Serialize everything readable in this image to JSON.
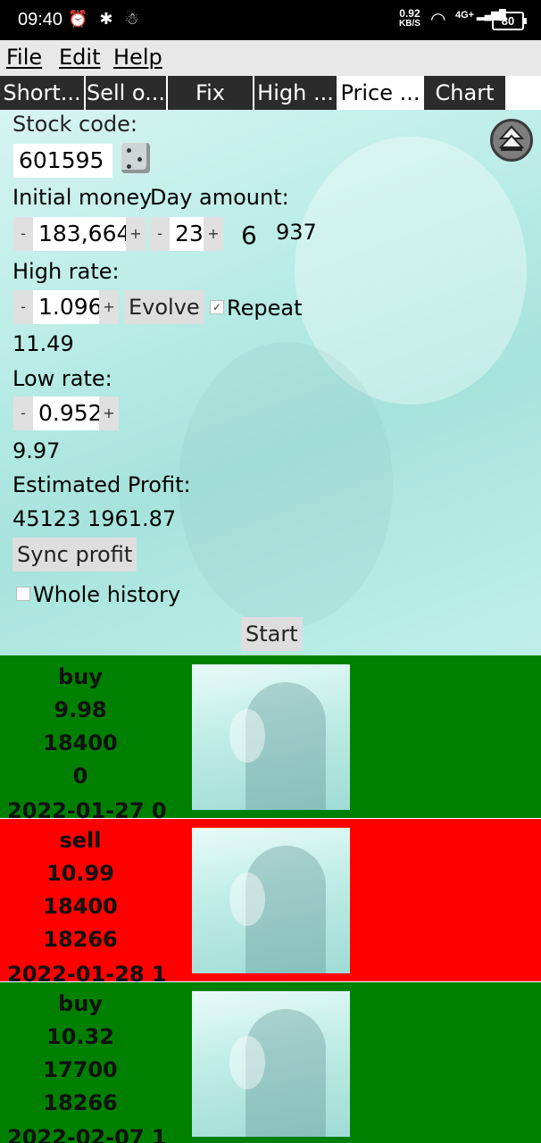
{
  "status_bar": {
    "time": "09:40",
    "left_icons": "⏰ ✱ ☃",
    "speed_value": "0.92",
    "speed_unit": "KB/S",
    "network": "4G+",
    "battery": "80"
  },
  "menu": [
    "File",
    "Edit",
    "Help"
  ],
  "tabs": [
    {
      "label": "Short..."
    },
    {
      "label": "Sell o..."
    },
    {
      "label": "Fix"
    },
    {
      "label": "High ..."
    },
    {
      "label": "Price ..."
    },
    {
      "label": "Chart"
    }
  ],
  "form": {
    "stock_code_label": "Stock code:",
    "stock_code_value": "601595",
    "initial_money_label": "Initial money",
    "day_amount_label": "Day amount:",
    "initial_money_value": "183,664",
    "day_amount_value": "23",
    "extra_a": "6",
    "extra_b": "937",
    "high_rate_label": "High rate:",
    "high_rate_value": "1.096",
    "evolve_label": "Evolve",
    "repeat_label": "Repeat",
    "repeat_checked": true,
    "high_price": "11.49",
    "low_rate_label": "Low rate:",
    "low_rate_value": "0.952",
    "low_price": "9.97",
    "estimated_profit_label": "Estimated Profit:",
    "estimated_profit_value": "45123 1961.87",
    "sync_profit_label": "Sync profit",
    "whole_history_label": "Whole history",
    "whole_history_checked": false,
    "start_label": "Start",
    "minus": "-",
    "plus": "+"
  },
  "transactions": [
    {
      "type": "buy",
      "price": "9.98",
      "shares": "18400",
      "profit": "0",
      "date": "2022-01-27 0"
    },
    {
      "type": "sell",
      "price": "10.99",
      "shares": "18400",
      "profit": "18266",
      "date": "2022-01-28 1"
    },
    {
      "type": "buy",
      "price": "10.32",
      "shares": "17700",
      "profit": "18266",
      "date": "2022-02-07 1"
    }
  ],
  "colors": {
    "buy": "#008000",
    "sell": "#ff0000"
  }
}
